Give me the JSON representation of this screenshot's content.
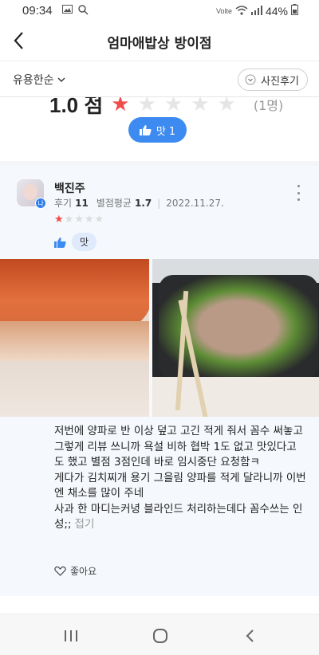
{
  "status": {
    "time": "09:34",
    "network": "Volte",
    "battery": "44%"
  },
  "header": {
    "title": "엄마애밥상 방이점"
  },
  "filter": {
    "sort_label": "유용한순",
    "photo_reviews_label": "사진후기"
  },
  "previous_review": {
    "rating": "1.0 점",
    "rating_count": "(1명)",
    "like_label": "맛 1"
  },
  "review": {
    "reviewer": "백진주",
    "level_badge": "나",
    "review_count_label": "후기",
    "review_count": "11",
    "avg_rating_label": "별점평균",
    "avg_rating": "1.7",
    "date": "2022.11.27.",
    "stars_filled": 1,
    "stars_total": 5,
    "tag": "맛",
    "text_lines": [
      "저번에 양파로 반 이상 덮고 고긴 적게 줘서 꼼수 써놓고 그렇게 리뷰 쓰니까 욕설 비하 협박 1도 없고 맛있다고도 했고 별점 3점인데 바로 임시중단 요청함ㅋ",
      "게다가 김치찌개 용기 그을림 양파를 적게 달라니까 이번엔 채소를 많이 주네",
      "사과 한 마디는커녕 블라인드 처리하는데다 꼼수쓰는 인성;;"
    ],
    "collapse_label": "접기",
    "like_label": "좋아요"
  },
  "colors": {
    "accent": "#3d8bf0",
    "star_on": "#f24b4b",
    "star_off": "#dcdcdc",
    "card_bg": "#f5f8fc"
  }
}
